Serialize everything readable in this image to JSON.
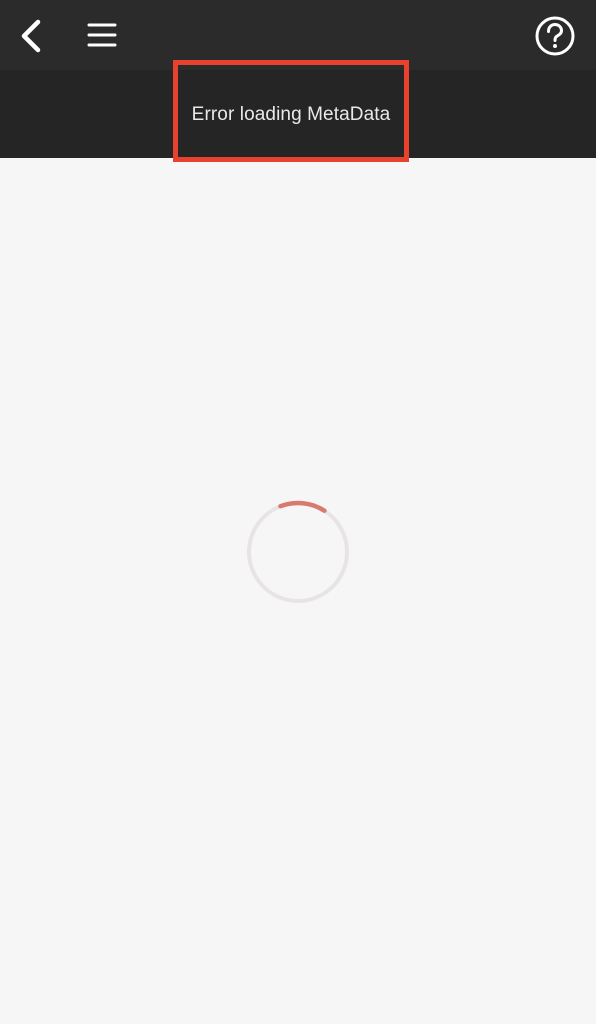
{
  "header": {
    "icons": {
      "back": "chevron-left-icon",
      "menu": "hamburger-menu-icon",
      "help": "question-circle-icon"
    }
  },
  "banner": {
    "message": "Error loading MetaData",
    "highlight_color": "#e8412e"
  },
  "loader": {
    "state": "loading",
    "track_color": "#e9e4e4",
    "arc_color": "#d97a6e"
  },
  "colors": {
    "topbar": "#2b2b2b",
    "subbar": "#252525",
    "background": "#f6f6f6"
  }
}
